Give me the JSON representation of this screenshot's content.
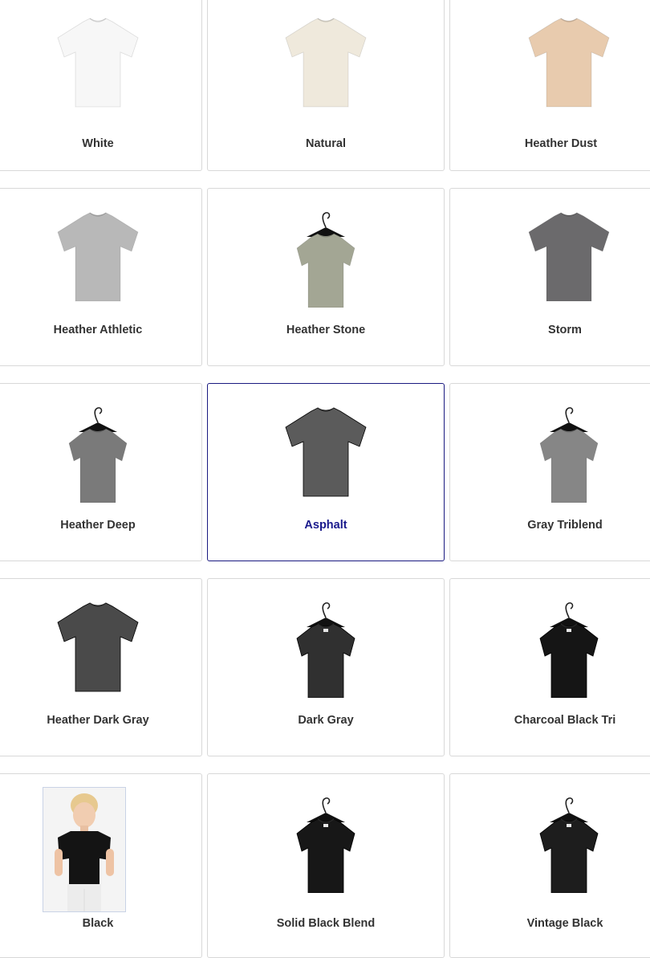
{
  "swatches": [
    {
      "label": "White",
      "color": "#f7f7f7",
      "hanger": false
    },
    {
      "label": "Natural",
      "color": "#efe9dc",
      "hanger": false
    },
    {
      "label": "Heather Dust",
      "color": "#e8cbae",
      "hanger": false
    },
    {
      "label": "Heather Athletic",
      "color": "#b8b8b8",
      "hanger": false
    },
    {
      "label": "Heather Stone",
      "color": "#a3a694",
      "hanger": true
    },
    {
      "label": "Storm",
      "color": "#6b6a6c",
      "hanger": false
    },
    {
      "label": "Heather Deep",
      "color": "#7a7a7a",
      "hanger": true
    },
    {
      "label": "Asphalt",
      "color": "#5b5b5b",
      "hanger": false,
      "selected": true
    },
    {
      "label": "Gray Triblend",
      "color": "#868686",
      "hanger": true
    },
    {
      "label": "Heather Dark Gray",
      "color": "#4a4a4a",
      "hanger": false
    },
    {
      "label": "Dark Gray",
      "color": "#303030",
      "hanger": true
    },
    {
      "label": "Charcoal Black Tri",
      "color": "#151515",
      "hanger": true
    },
    {
      "label": "Black",
      "color": "#121212",
      "hanger": false,
      "photo": true
    },
    {
      "label": "Solid Black Blend",
      "color": "#171717",
      "hanger": true
    },
    {
      "label": "Vintage Black",
      "color": "#1d1d1d",
      "hanger": true
    }
  ],
  "colors": {
    "selected_border": "#1a1a80",
    "selected_text": "#1a1a8c",
    "label_text": "#333333",
    "card_border": "#d8d8d8"
  },
  "icons": {
    "tshirt": "tshirt-icon",
    "hanger": "hanger-icon"
  }
}
